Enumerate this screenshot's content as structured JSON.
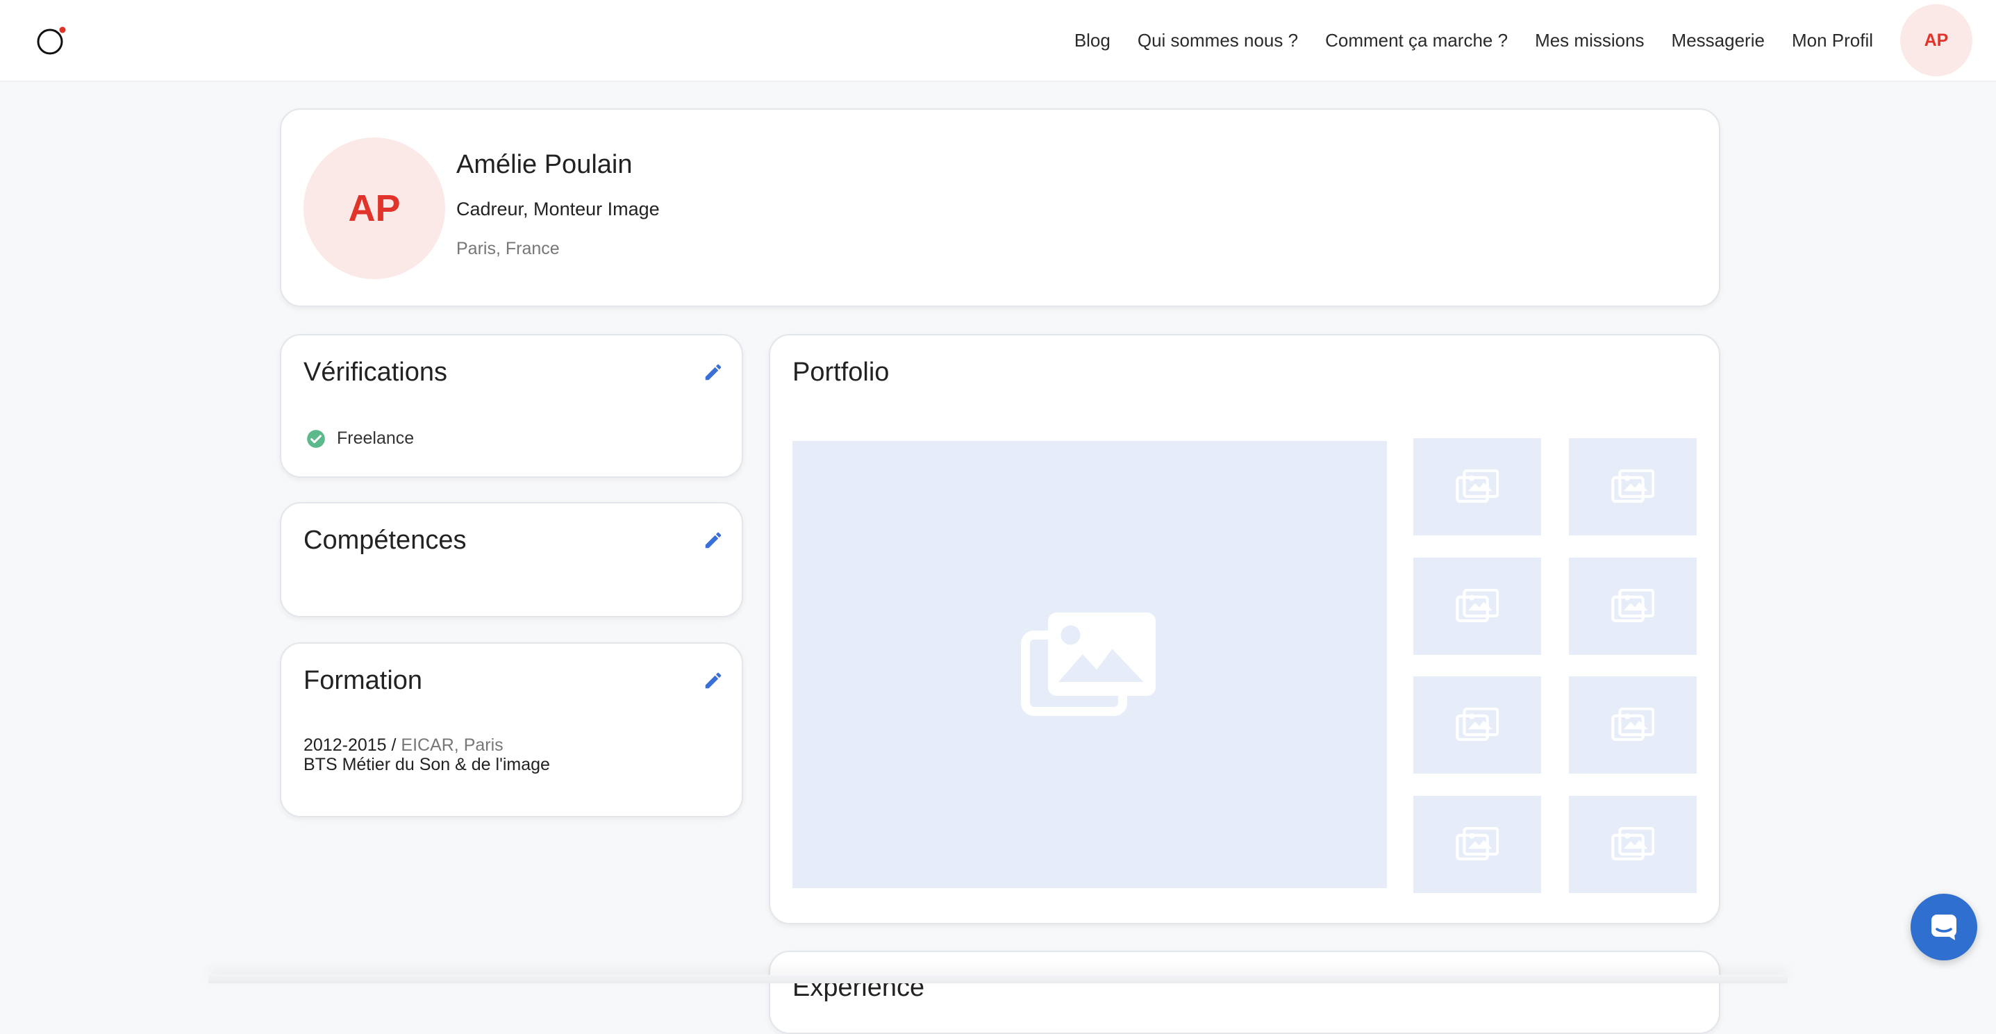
{
  "nav": {
    "items": [
      "Blog",
      "Qui sommes nous ?",
      "Comment ça marche ?",
      "Mes missions",
      "Messagerie",
      "Mon Profil"
    ],
    "avatar_initials": "AP"
  },
  "profile": {
    "initials": "AP",
    "name": "Amélie Poulain",
    "role": "Cadreur, Monteur Image",
    "location": "Paris, France"
  },
  "verifications": {
    "title": "Vérifications",
    "items": [
      "Freelance"
    ]
  },
  "competences": {
    "title": "Compétences"
  },
  "formation": {
    "title": "Formation",
    "years": "2012-2015 / ",
    "school": "EICAR, Paris",
    "degree": "BTS Métier du Son & de l'image"
  },
  "portfolio": {
    "title": "Portfolio",
    "thumbnail_count": 8
  },
  "experience": {
    "title": "Expérience"
  },
  "colors": {
    "accent_red": "#e0342b",
    "avatar_bg": "#fbe9e8",
    "edit_blue": "#3a6fd8",
    "check_green": "#5cb98c",
    "placeholder_bg": "#e7edf8",
    "chat_blue": "#2f6fd0"
  }
}
